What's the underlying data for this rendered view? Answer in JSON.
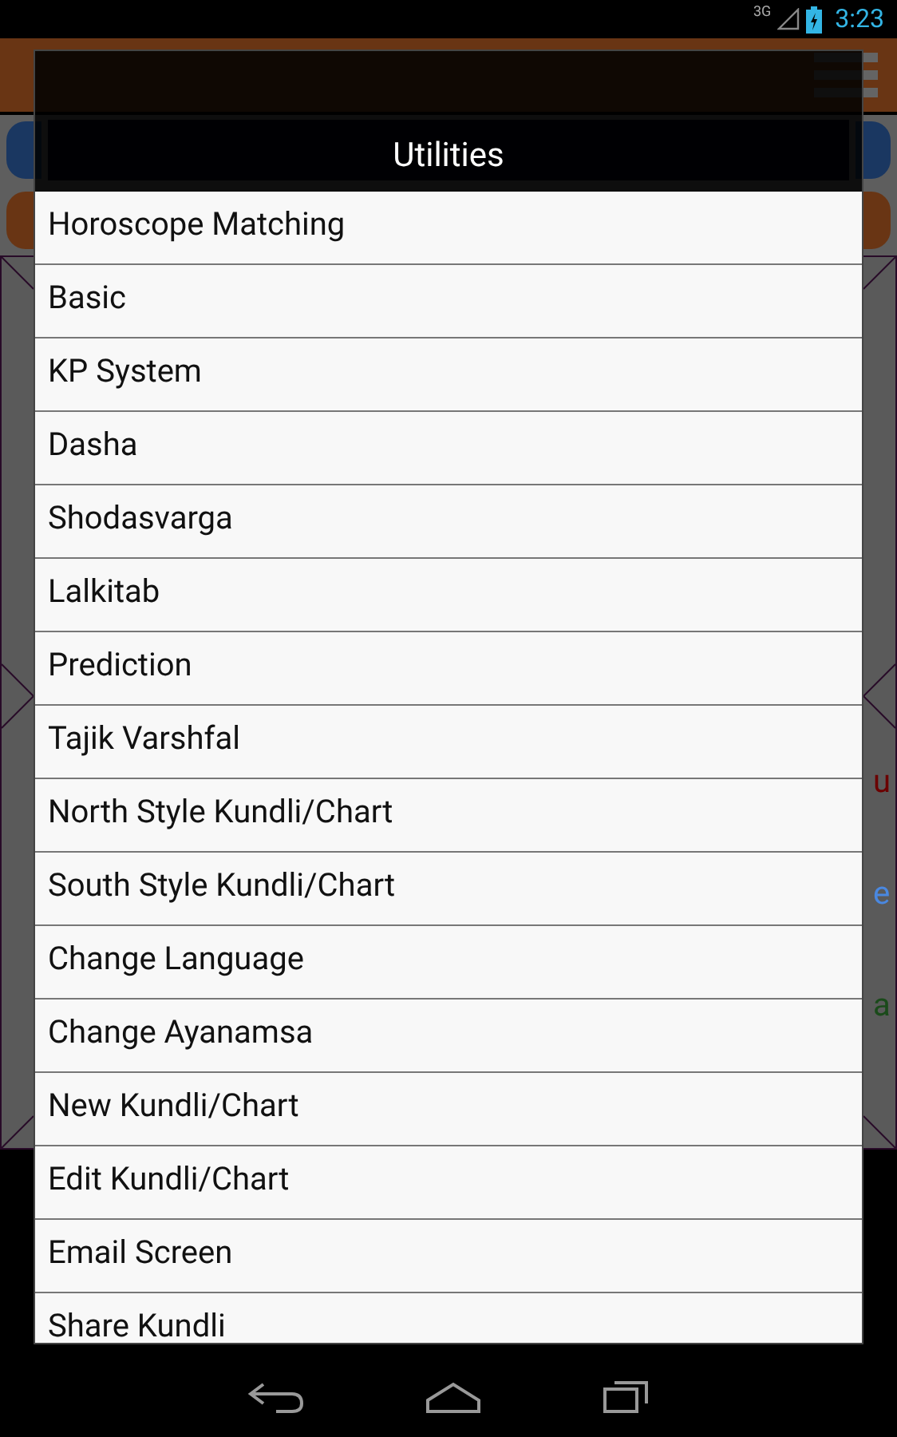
{
  "status_bar": {
    "network": "3G",
    "time": "3:23"
  },
  "app": {
    "edge_letters": [
      {
        "text": "u",
        "color": "#6b0000"
      },
      {
        "text": "e",
        "color": "#4a88e0"
      },
      {
        "text": "a",
        "color": "#1a4a1a"
      }
    ]
  },
  "dialog": {
    "title": "Utilities",
    "items": [
      {
        "label": "Horoscope Matching"
      },
      {
        "label": "Basic"
      },
      {
        "label": "KP System"
      },
      {
        "label": "Dasha"
      },
      {
        "label": "Shodasvarga"
      },
      {
        "label": "Lalkitab"
      },
      {
        "label": "Prediction"
      },
      {
        "label": "Tajik Varshfal"
      },
      {
        "label": "North Style Kundli/Chart"
      },
      {
        "label": "South Style Kundli/Chart"
      },
      {
        "label": "Change Language"
      },
      {
        "label": "Change Ayanamsa"
      },
      {
        "label": "New Kundli/Chart"
      },
      {
        "label": "Edit Kundli/Chart"
      },
      {
        "label": "Email Screen"
      },
      {
        "label": "Share Kundli"
      }
    ]
  }
}
